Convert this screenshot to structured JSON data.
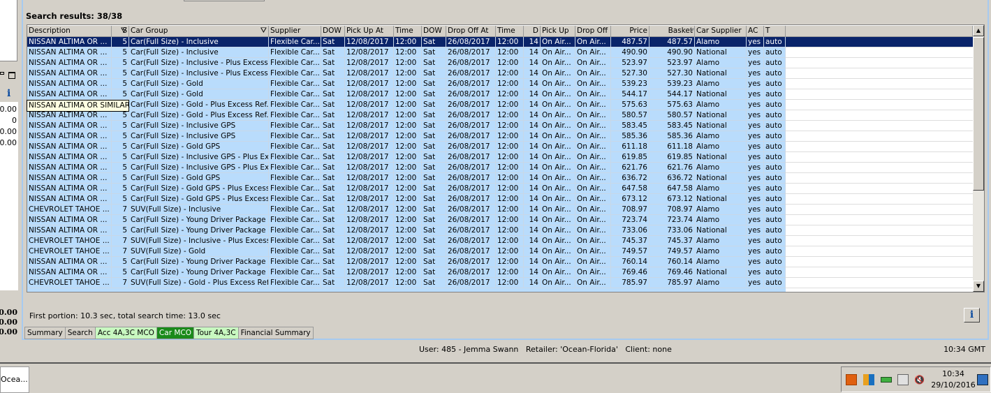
{
  "search": {
    "results_title": "Search results: 38/38",
    "timing": "First portion: 10.3 sec, total search time: 13.0 sec",
    "tooltip": "NISSAN ALTIMA OR SIMILAR",
    "info_label": "i"
  },
  "left_panel": {
    "values": [
      "0.00",
      "0",
      "0.00",
      "0.00"
    ],
    "totals": [
      "0.00",
      "0.00",
      "0.00"
    ],
    "info_label": "i"
  },
  "columns": [
    "Description",
    "S",
    "Car Group",
    "Supplier",
    "DOW",
    "Pick Up At",
    "Time",
    "DOW",
    "Drop Off At",
    "Time",
    "D",
    "Pick Up",
    "Drop Off",
    "Price",
    "Basket",
    "Car Supplier",
    "AC",
    "T"
  ],
  "rows": [
    [
      "NISSAN ALTIMA OR ...",
      "5",
      "Car(Full Size) - Inclusive",
      "Flexible Car...",
      "Sat",
      "12/08/2017",
      "12:00",
      "Sat",
      "26/08/2017",
      "12:00",
      "14",
      "On Air...",
      "On Air...",
      "487.57",
      "487.57",
      "Alamo",
      "yes",
      "auto"
    ],
    [
      "NISSAN ALTIMA OR ...",
      "5",
      "Car(Full Size) - Inclusive",
      "Flexible Car...",
      "Sat",
      "12/08/2017",
      "12:00",
      "Sat",
      "26/08/2017",
      "12:00",
      "14",
      "On Air...",
      "On Air...",
      "490.90",
      "490.90",
      "National",
      "yes",
      "auto"
    ],
    [
      "NISSAN ALTIMA OR ...",
      "5",
      "Car(Full Size) - Inclusive - Plus Excess...",
      "Flexible Car...",
      "Sat",
      "12/08/2017",
      "12:00",
      "Sat",
      "26/08/2017",
      "12:00",
      "14",
      "On Air...",
      "On Air...",
      "523.97",
      "523.97",
      "Alamo",
      "yes",
      "auto"
    ],
    [
      "NISSAN ALTIMA OR ...",
      "5",
      "Car(Full Size) - Inclusive - Plus Excess...",
      "Flexible Car...",
      "Sat",
      "12/08/2017",
      "12:00",
      "Sat",
      "26/08/2017",
      "12:00",
      "14",
      "On Air...",
      "On Air...",
      "527.30",
      "527.30",
      "National",
      "yes",
      "auto"
    ],
    [
      "NISSAN ALTIMA OR ...",
      "5",
      "Car(Full Size) - Gold",
      "Flexible Car...",
      "Sat",
      "12/08/2017",
      "12:00",
      "Sat",
      "26/08/2017",
      "12:00",
      "14",
      "On Air...",
      "On Air...",
      "539.23",
      "539.23",
      "Alamo",
      "yes",
      "auto"
    ],
    [
      "NISSAN ALTIMA OR ...",
      "5",
      "Car(Full Size) - Gold",
      "Flexible Car...",
      "Sat",
      "12/08/2017",
      "12:00",
      "Sat",
      "26/08/2017",
      "12:00",
      "14",
      "On Air...",
      "On Air...",
      "544.17",
      "544.17",
      "National",
      "yes",
      "auto"
    ],
    [
      "NISSAN ALTIMA OR ...",
      "5",
      "Car(Full Size) - Gold - Plus Excess Ref...",
      "Flexible Car...",
      "Sat",
      "12/08/2017",
      "12:00",
      "Sat",
      "26/08/2017",
      "12:00",
      "14",
      "On Air...",
      "On Air...",
      "575.63",
      "575.63",
      "Alamo",
      "yes",
      "auto"
    ],
    [
      "NISSAN ALTIMA OR ...",
      "5",
      "Car(Full Size) - Gold - Plus Excess Ref...",
      "Flexible Car...",
      "Sat",
      "12/08/2017",
      "12:00",
      "Sat",
      "26/08/2017",
      "12:00",
      "14",
      "On Air...",
      "On Air...",
      "580.57",
      "580.57",
      "National",
      "yes",
      "auto"
    ],
    [
      "NISSAN ALTIMA OR ...",
      "5",
      "Car(Full Size) - Inclusive GPS",
      "Flexible Car...",
      "Sat",
      "12/08/2017",
      "12:00",
      "Sat",
      "26/08/2017",
      "12:00",
      "14",
      "On Air...",
      "On Air...",
      "583.45",
      "583.45",
      "National",
      "yes",
      "auto"
    ],
    [
      "NISSAN ALTIMA OR ...",
      "5",
      "Car(Full Size) - Inclusive GPS",
      "Flexible Car...",
      "Sat",
      "12/08/2017",
      "12:00",
      "Sat",
      "26/08/2017",
      "12:00",
      "14",
      "On Air...",
      "On Air...",
      "585.36",
      "585.36",
      "Alamo",
      "yes",
      "auto"
    ],
    [
      "NISSAN ALTIMA OR ...",
      "5",
      "Car(Full Size) - Gold GPS",
      "Flexible Car...",
      "Sat",
      "12/08/2017",
      "12:00",
      "Sat",
      "26/08/2017",
      "12:00",
      "14",
      "On Air...",
      "On Air...",
      "611.18",
      "611.18",
      "Alamo",
      "yes",
      "auto"
    ],
    [
      "NISSAN ALTIMA OR ...",
      "5",
      "Car(Full Size) - Inclusive GPS - Plus Ex...",
      "Flexible Car...",
      "Sat",
      "12/08/2017",
      "12:00",
      "Sat",
      "26/08/2017",
      "12:00",
      "14",
      "On Air...",
      "On Air...",
      "619.85",
      "619.85",
      "National",
      "yes",
      "auto"
    ],
    [
      "NISSAN ALTIMA OR ...",
      "5",
      "Car(Full Size) - Inclusive GPS - Plus Ex...",
      "Flexible Car...",
      "Sat",
      "12/08/2017",
      "12:00",
      "Sat",
      "26/08/2017",
      "12:00",
      "14",
      "On Air...",
      "On Air...",
      "621.76",
      "621.76",
      "Alamo",
      "yes",
      "auto"
    ],
    [
      "NISSAN ALTIMA OR ...",
      "5",
      "Car(Full Size) - Gold GPS",
      "Flexible Car...",
      "Sat",
      "12/08/2017",
      "12:00",
      "Sat",
      "26/08/2017",
      "12:00",
      "14",
      "On Air...",
      "On Air...",
      "636.72",
      "636.72",
      "National",
      "yes",
      "auto"
    ],
    [
      "NISSAN ALTIMA OR ...",
      "5",
      "Car(Full Size) - Gold GPS - Plus Excess...",
      "Flexible Car...",
      "Sat",
      "12/08/2017",
      "12:00",
      "Sat",
      "26/08/2017",
      "12:00",
      "14",
      "On Air...",
      "On Air...",
      "647.58",
      "647.58",
      "Alamo",
      "yes",
      "auto"
    ],
    [
      "NISSAN ALTIMA OR ...",
      "5",
      "Car(Full Size) - Gold GPS - Plus Excess...",
      "Flexible Car...",
      "Sat",
      "12/08/2017",
      "12:00",
      "Sat",
      "26/08/2017",
      "12:00",
      "14",
      "On Air...",
      "On Air...",
      "673.12",
      "673.12",
      "National",
      "yes",
      "auto"
    ],
    [
      "CHEVROLET TAHOE ...",
      "7",
      "SUV(Full Size) - Inclusive",
      "Flexible Car...",
      "Sat",
      "12/08/2017",
      "12:00",
      "Sat",
      "26/08/2017",
      "12:00",
      "14",
      "On Air...",
      "On Air...",
      "708.97",
      "708.97",
      "Alamo",
      "yes",
      "auto"
    ],
    [
      "NISSAN ALTIMA OR ...",
      "5",
      "Car(Full Size) - Young Driver Package ...",
      "Flexible Car...",
      "Sat",
      "12/08/2017",
      "12:00",
      "Sat",
      "26/08/2017",
      "12:00",
      "14",
      "On Air...",
      "On Air...",
      "723.74",
      "723.74",
      "Alamo",
      "yes",
      "auto"
    ],
    [
      "NISSAN ALTIMA OR ...",
      "5",
      "Car(Full Size) - Young Driver Package ...",
      "Flexible Car...",
      "Sat",
      "12/08/2017",
      "12:00",
      "Sat",
      "26/08/2017",
      "12:00",
      "14",
      "On Air...",
      "On Air...",
      "733.06",
      "733.06",
      "National",
      "yes",
      "auto"
    ],
    [
      "CHEVROLET TAHOE ...",
      "7",
      "SUV(Full Size) - Inclusive - Plus Excess...",
      "Flexible Car...",
      "Sat",
      "12/08/2017",
      "12:00",
      "Sat",
      "26/08/2017",
      "12:00",
      "14",
      "On Air...",
      "On Air...",
      "745.37",
      "745.37",
      "Alamo",
      "yes",
      "auto"
    ],
    [
      "CHEVROLET TAHOE ...",
      "7",
      "SUV(Full Size) - Gold",
      "Flexible Car...",
      "Sat",
      "12/08/2017",
      "12:00",
      "Sat",
      "26/08/2017",
      "12:00",
      "14",
      "On Air...",
      "On Air...",
      "749.57",
      "749.57",
      "Alamo",
      "yes",
      "auto"
    ],
    [
      "NISSAN ALTIMA OR ...",
      "5",
      "Car(Full Size) - Young Driver Package ...",
      "Flexible Car...",
      "Sat",
      "12/08/2017",
      "12:00",
      "Sat",
      "26/08/2017",
      "12:00",
      "14",
      "On Air...",
      "On Air...",
      "760.14",
      "760.14",
      "Alamo",
      "yes",
      "auto"
    ],
    [
      "NISSAN ALTIMA OR ...",
      "5",
      "Car(Full Size) - Young Driver Package ...",
      "Flexible Car...",
      "Sat",
      "12/08/2017",
      "12:00",
      "Sat",
      "26/08/2017",
      "12:00",
      "14",
      "On Air...",
      "On Air...",
      "769.46",
      "769.46",
      "National",
      "yes",
      "auto"
    ],
    [
      "CHEVROLET TAHOE ...",
      "7",
      "SUV(Full Size) - Gold - Plus Excess Ref...",
      "Flexible Car...",
      "Sat",
      "12/08/2017",
      "12:00",
      "Sat",
      "26/08/2017",
      "12:00",
      "14",
      "On Air...",
      "On Air...",
      "785.97",
      "785.97",
      "Alamo",
      "yes",
      "auto"
    ]
  ],
  "selected_row": 0,
  "tabs": [
    {
      "label": "Summary",
      "style": "normal"
    },
    {
      "label": "Search",
      "style": "normal"
    },
    {
      "label": "Acc 4A,3C MCO",
      "style": "green"
    },
    {
      "label": "Car MCO",
      "style": "active"
    },
    {
      "label": "Tour 4A,3C",
      "style": "green"
    },
    {
      "label": "Financial Summary",
      "style": "normal"
    }
  ],
  "status": {
    "line": "User: 485 - Jemma Swann   Retailer: 'Ocean-Florida'   Client: none",
    "time": "10:34 GMT"
  },
  "taskbar": {
    "button": "Ocea...",
    "clock_time": "10:34",
    "clock_date": "29/10/2016",
    "tray_icons": [
      "java-icon",
      "avg-antivirus-icon",
      "network-card-icon",
      "network-connection-icon",
      "volume-muted-icon",
      "show-desktop-icon"
    ]
  },
  "colors": {
    "selected_row": "#0a246a",
    "row_bg": "#b9dcfc",
    "active_tab": "#1a8a1a",
    "green_tab": "#c8f8c0"
  }
}
